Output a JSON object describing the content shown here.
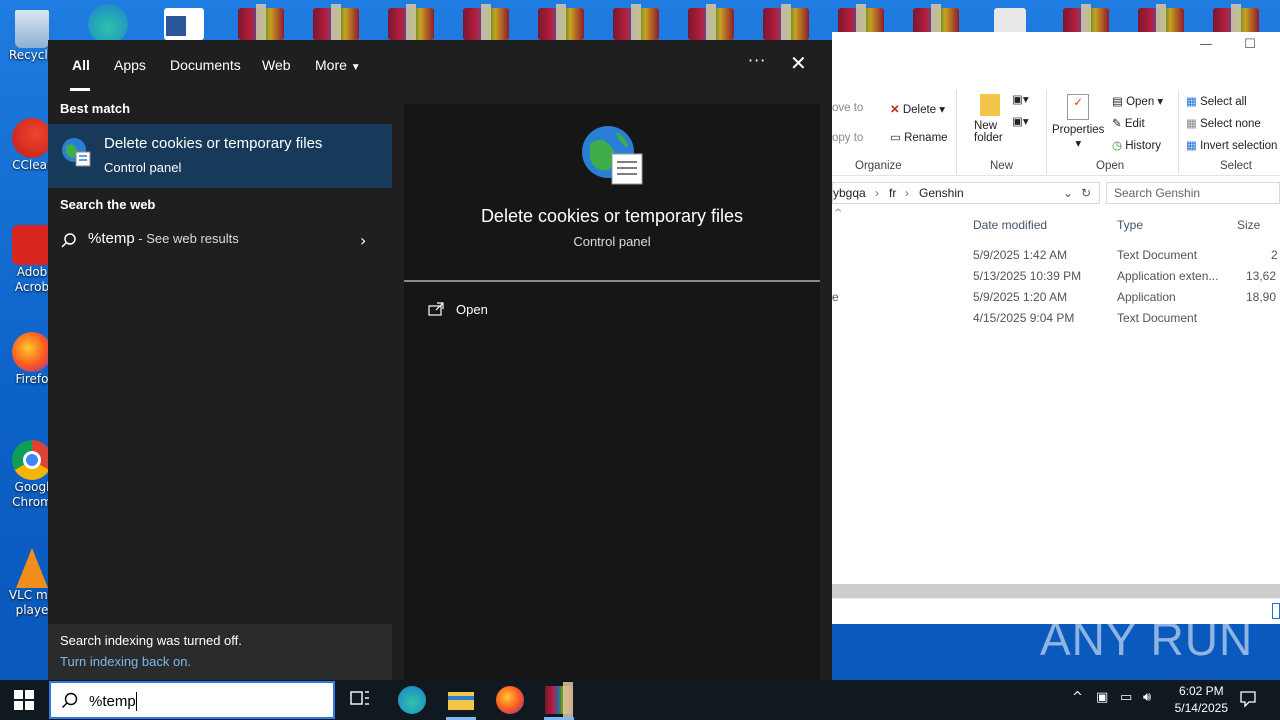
{
  "desktop": {
    "icons": [
      {
        "label": "Recycle"
      },
      {
        "label": "CClear"
      },
      {
        "label": "Adob"
      },
      {
        "label": "Acrob"
      },
      {
        "label": "Firefo"
      },
      {
        "label": "Googl"
      },
      {
        "label": "Chrom"
      },
      {
        "label": "VLC me"
      },
      {
        "label": "playe"
      }
    ]
  },
  "explorer": {
    "ribbon": {
      "move_to": "ove to",
      "copy_to": "opy to",
      "delete": "Delete",
      "rename": "Rename",
      "new_folder_1": "New",
      "new_folder_2": "folder",
      "properties": "Properties",
      "open": "Open",
      "edit": "Edit",
      "history": "History",
      "select_all": "Select all",
      "select_none": "Select none",
      "invert_selection": "Invert selection",
      "groups": {
        "organize": "Organize",
        "new": "New",
        "open": "Open",
        "select": "Select"
      }
    },
    "address": {
      "seg1": "ybgqa",
      "seg2": "fr",
      "seg3": "Genshin",
      "sep": "›"
    },
    "search_placeholder": "Search Genshin",
    "columns": {
      "date": "Date modified",
      "type": "Type",
      "size": "Size"
    },
    "rows": [
      {
        "name_frag": "",
        "date": "5/9/2025 1:42 AM",
        "type": "Text Document",
        "size": "2"
      },
      {
        "name_frag": "",
        "date": "5/13/2025 10:39 PM",
        "type": "Application exten...",
        "size": "13,62"
      },
      {
        "name_frag": "e",
        "date": "5/9/2025 1:20 AM",
        "type": "Application",
        "size": "18,90"
      },
      {
        "name_frag": "",
        "date": "4/15/2025 9:04 PM",
        "type": "Text Document",
        "size": ""
      }
    ]
  },
  "watermark": "ANY RUN",
  "search_panel": {
    "tabs": [
      {
        "label": "All"
      },
      {
        "label": "Apps"
      },
      {
        "label": "Documents"
      },
      {
        "label": "Web"
      },
      {
        "label": "More"
      }
    ],
    "more_icon": "ellipsis-icon",
    "best_match_header": "Best match",
    "best_match": {
      "title": "Delete cookies or temporary files",
      "subtitle": "Control panel"
    },
    "web_header": "Search the web",
    "web_result": {
      "query": "%temp",
      "suffix": " - See web results"
    },
    "indexing": {
      "message": "Search indexing was turned off.",
      "link": "Turn indexing back on."
    },
    "preview": {
      "title": "Delete cookies or temporary files",
      "subtitle": "Control panel",
      "action": "Open"
    }
  },
  "taskbar": {
    "search_value": "%temp",
    "time": "6:02 PM",
    "date": "5/14/2025"
  }
}
